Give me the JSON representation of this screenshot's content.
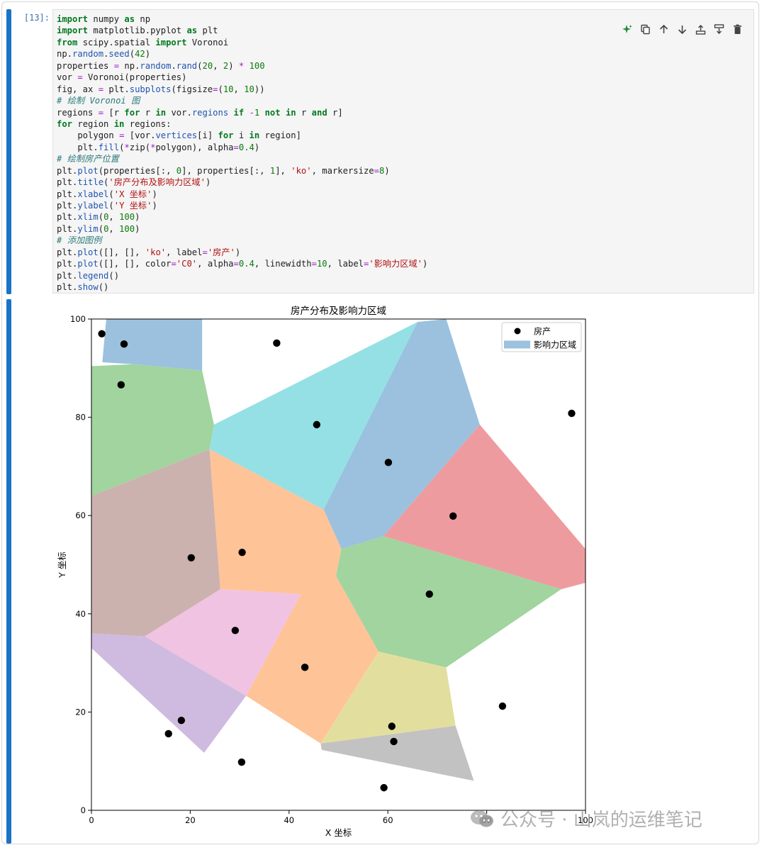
{
  "cell": {
    "prompt": "[13]:",
    "code_lines": [
      [
        [
          "kw",
          "import"
        ],
        [
          "t",
          " numpy "
        ],
        [
          "kw",
          "as"
        ],
        [
          "t",
          " np"
        ]
      ],
      [
        [
          "kw",
          "import"
        ],
        [
          "t",
          " matplotlib.pyplot "
        ],
        [
          "kw",
          "as"
        ],
        [
          "t",
          " plt"
        ]
      ],
      [
        [
          "kw",
          "from"
        ],
        [
          "t",
          " scipy.spatial "
        ],
        [
          "kw",
          "import"
        ],
        [
          "t",
          " Voronoi"
        ]
      ],
      [
        [
          "t",
          "np."
        ],
        [
          "fn",
          "random"
        ],
        [
          "t",
          "."
        ],
        [
          "fn",
          "seed"
        ],
        [
          "t",
          "("
        ],
        [
          "num",
          "42"
        ],
        [
          "t",
          ")"
        ]
      ],
      [
        [
          "t",
          "properties "
        ],
        [
          "op",
          "="
        ],
        [
          "t",
          " np."
        ],
        [
          "fn",
          "random"
        ],
        [
          "t",
          "."
        ],
        [
          "fn",
          "rand"
        ],
        [
          "t",
          "("
        ],
        [
          "num",
          "20"
        ],
        [
          "t",
          ", "
        ],
        [
          "num",
          "2"
        ],
        [
          "t",
          ") "
        ],
        [
          "op",
          "*"
        ],
        [
          "t",
          " "
        ],
        [
          "num",
          "100"
        ]
      ],
      [
        [
          "t",
          "vor "
        ],
        [
          "op",
          "="
        ],
        [
          "t",
          " Voronoi(properties)"
        ]
      ],
      [
        [
          "t",
          "fig, ax "
        ],
        [
          "op",
          "="
        ],
        [
          "t",
          " plt."
        ],
        [
          "fn",
          "subplots"
        ],
        [
          "t",
          "(figsize"
        ],
        [
          "op",
          "="
        ],
        [
          "t",
          "("
        ],
        [
          "num",
          "10"
        ],
        [
          "t",
          ", "
        ],
        [
          "num",
          "10"
        ],
        [
          "t",
          "))"
        ]
      ],
      [
        [
          "cm",
          "# 绘制 Voronoi 图"
        ]
      ],
      [
        [
          "t",
          "regions "
        ],
        [
          "op",
          "="
        ],
        [
          "t",
          " [r "
        ],
        [
          "kw",
          "for"
        ],
        [
          "t",
          " r "
        ],
        [
          "kw",
          "in"
        ],
        [
          "t",
          " vor."
        ],
        [
          "fn",
          "regions"
        ],
        [
          "t",
          " "
        ],
        [
          "kw",
          "if"
        ],
        [
          "t",
          " "
        ],
        [
          "op",
          "-"
        ],
        [
          "num",
          "1"
        ],
        [
          "t",
          " "
        ],
        [
          "kw",
          "not"
        ],
        [
          "t",
          " "
        ],
        [
          "kw",
          "in"
        ],
        [
          "t",
          " r "
        ],
        [
          "kw",
          "and"
        ],
        [
          "t",
          " r]"
        ]
      ],
      [
        [
          "kw",
          "for"
        ],
        [
          "t",
          " region "
        ],
        [
          "kw",
          "in"
        ],
        [
          "t",
          " regions:"
        ]
      ],
      [
        [
          "t",
          "    polygon "
        ],
        [
          "op",
          "="
        ],
        [
          "t",
          " [vor."
        ],
        [
          "fn",
          "vertices"
        ],
        [
          "t",
          "[i] "
        ],
        [
          "kw",
          "for"
        ],
        [
          "t",
          " i "
        ],
        [
          "kw",
          "in"
        ],
        [
          "t",
          " region]"
        ]
      ],
      [
        [
          "t",
          "    plt."
        ],
        [
          "fn",
          "fill"
        ],
        [
          "t",
          "("
        ],
        [
          "op",
          "*"
        ],
        [
          "t",
          "zip("
        ],
        [
          "op",
          "*"
        ],
        [
          "t",
          "polygon), alpha"
        ],
        [
          "op",
          "="
        ],
        [
          "num",
          "0.4"
        ],
        [
          "t",
          ")"
        ]
      ],
      [
        [
          "cm",
          "# 绘制房产位置"
        ]
      ],
      [
        [
          "t",
          "plt."
        ],
        [
          "fn",
          "plot"
        ],
        [
          "t",
          "(properties[:, "
        ],
        [
          "num",
          "0"
        ],
        [
          "t",
          "], properties[:, "
        ],
        [
          "num",
          "1"
        ],
        [
          "t",
          "], "
        ],
        [
          "str",
          "'ko'"
        ],
        [
          "t",
          ", markersize"
        ],
        [
          "op",
          "="
        ],
        [
          "num",
          "8"
        ],
        [
          "t",
          ")"
        ]
      ],
      [
        [
          "t",
          "plt."
        ],
        [
          "fn",
          "title"
        ],
        [
          "t",
          "("
        ],
        [
          "str",
          "'房产分布及影响力区域'"
        ],
        [
          "t",
          ")"
        ]
      ],
      [
        [
          "t",
          "plt."
        ],
        [
          "fn",
          "xlabel"
        ],
        [
          "t",
          "("
        ],
        [
          "str",
          "'X 坐标'"
        ],
        [
          "t",
          ")"
        ]
      ],
      [
        [
          "t",
          "plt."
        ],
        [
          "fn",
          "ylabel"
        ],
        [
          "t",
          "("
        ],
        [
          "str",
          "'Y 坐标'"
        ],
        [
          "t",
          ")"
        ]
      ],
      [
        [
          "t",
          "plt."
        ],
        [
          "fn",
          "xlim"
        ],
        [
          "t",
          "("
        ],
        [
          "num",
          "0"
        ],
        [
          "t",
          ", "
        ],
        [
          "num",
          "100"
        ],
        [
          "t",
          ")"
        ]
      ],
      [
        [
          "t",
          "plt."
        ],
        [
          "fn",
          "ylim"
        ],
        [
          "t",
          "("
        ],
        [
          "num",
          "0"
        ],
        [
          "t",
          ", "
        ],
        [
          "num",
          "100"
        ],
        [
          "t",
          ")"
        ]
      ],
      [
        [
          "cm",
          "# 添加图例"
        ]
      ],
      [
        [
          "t",
          "plt."
        ],
        [
          "fn",
          "plot"
        ],
        [
          "t",
          "([], [], "
        ],
        [
          "str",
          "'ko'"
        ],
        [
          "t",
          ", label"
        ],
        [
          "op",
          "="
        ],
        [
          "str",
          "'房产'"
        ],
        [
          "t",
          ")"
        ]
      ],
      [
        [
          "t",
          "plt."
        ],
        [
          "fn",
          "plot"
        ],
        [
          "t",
          "([], [], color"
        ],
        [
          "op",
          "="
        ],
        [
          "str",
          "'C0'"
        ],
        [
          "t",
          ", alpha"
        ],
        [
          "op",
          "="
        ],
        [
          "num",
          "0.4"
        ],
        [
          "t",
          ", linewidth"
        ],
        [
          "op",
          "="
        ],
        [
          "num",
          "10"
        ],
        [
          "t",
          ", label"
        ],
        [
          "op",
          "="
        ],
        [
          "str",
          "'影响力区域'"
        ],
        [
          "t",
          ")"
        ]
      ],
      [
        [
          "t",
          "plt."
        ],
        [
          "fn",
          "legend"
        ],
        [
          "t",
          "()"
        ]
      ],
      [
        [
          "t",
          "plt."
        ],
        [
          "fn",
          "show"
        ],
        [
          "t",
          "()"
        ]
      ]
    ],
    "toolbar": [
      {
        "name": "ai-assist-icon",
        "label": "AI assist"
      },
      {
        "name": "copy-icon",
        "label": "Duplicate"
      },
      {
        "name": "move-up-icon",
        "label": "Move up"
      },
      {
        "name": "move-down-icon",
        "label": "Move down"
      },
      {
        "name": "insert-above-icon",
        "label": "Insert above"
      },
      {
        "name": "insert-below-icon",
        "label": "Insert below"
      },
      {
        "name": "delete-icon",
        "label": "Delete"
      }
    ]
  },
  "watermark": "公众号 · 山岚的运维笔记",
  "chart_data": {
    "type": "scatter",
    "title": "房产分布及影响力区域",
    "xlabel": "X 坐标",
    "ylabel": "Y 坐标",
    "xlim": [
      0,
      100
    ],
    "ylim": [
      0,
      100
    ],
    "xticks": [
      0,
      20,
      40,
      60,
      80,
      100
    ],
    "yticks": [
      0,
      20,
      40,
      60,
      80,
      100
    ],
    "legend": [
      {
        "label": "房产",
        "kind": "marker",
        "color": "#000000"
      },
      {
        "label": "影响力区域",
        "kind": "patch",
        "color": "#9bc1de"
      }
    ],
    "legend_position": "top-right",
    "points": [
      [
        2.1,
        97.0
      ],
      [
        6.6,
        94.9
      ],
      [
        6.0,
        86.6
      ],
      [
        37.5,
        95.1
      ],
      [
        45.6,
        78.5
      ],
      [
        60.1,
        70.8
      ],
      [
        97.2,
        80.8
      ],
      [
        73.2,
        59.9
      ],
      [
        30.5,
        52.5
      ],
      [
        20.2,
        51.4
      ],
      [
        68.4,
        44.0
      ],
      [
        29.1,
        36.6
      ],
      [
        43.2,
        29.1
      ],
      [
        18.2,
        18.3
      ],
      [
        15.6,
        15.6
      ],
      [
        60.8,
        17.1
      ],
      [
        61.2,
        14.0
      ],
      [
        83.2,
        21.2
      ],
      [
        30.4,
        9.8
      ],
      [
        59.2,
        4.6
      ]
    ],
    "regions": [
      {
        "color": "#9bc1de",
        "vertices": [
          [
            2.2,
            91.2
          ],
          [
            3.0,
            100
          ],
          [
            22.4,
            100
          ],
          [
            22.4,
            89.5
          ],
          [
            8.5,
            90.8
          ]
        ]
      },
      {
        "color": "#a1d49e",
        "vertices": [
          [
            0,
            90.4
          ],
          [
            8.5,
            90.8
          ],
          [
            22.4,
            89.5
          ],
          [
            24.8,
            78.5
          ],
          [
            23.9,
            73.5
          ],
          [
            0,
            64.0
          ]
        ]
      },
      {
        "color": "#94e0e5",
        "vertices": [
          [
            24.8,
            78.5
          ],
          [
            66.0,
            99.4
          ],
          [
            47.0,
            61.2
          ],
          [
            23.9,
            73.5
          ]
        ]
      },
      {
        "color": "#9bc1de",
        "vertices": [
          [
            66.0,
            99.4
          ],
          [
            71.8,
            100
          ],
          [
            78.6,
            78.5
          ],
          [
            59.1,
            55.8
          ],
          [
            50.6,
            53.2
          ],
          [
            47.0,
            61.2
          ]
        ]
      },
      {
        "color": "#ee9b9f",
        "vertices": [
          [
            78.6,
            78.5
          ],
          [
            100,
            53.2
          ],
          [
            100,
            46.3
          ],
          [
            95.1,
            45.0
          ],
          [
            59.1,
            55.8
          ]
        ]
      },
      {
        "color": "#ccb2ae",
        "vertices": [
          [
            0,
            64.0
          ],
          [
            23.9,
            73.5
          ],
          [
            26.1,
            45.0
          ],
          [
            10.8,
            35.4
          ],
          [
            0,
            36.0
          ]
        ]
      },
      {
        "color": "#ffc398",
        "vertices": [
          [
            23.9,
            73.5
          ],
          [
            47.0,
            61.2
          ],
          [
            50.6,
            53.2
          ],
          [
            49.5,
            47.7
          ],
          [
            58.1,
            32.3
          ],
          [
            46.4,
            13.6
          ],
          [
            31.3,
            23.3
          ],
          [
            42.4,
            44.0
          ],
          [
            26.1,
            45.0
          ]
        ]
      },
      {
        "color": "#a1d49e",
        "vertices": [
          [
            50.6,
            53.2
          ],
          [
            59.1,
            55.8
          ],
          [
            95.1,
            45.0
          ],
          [
            71.8,
            29.1
          ],
          [
            58.1,
            32.3
          ],
          [
            49.5,
            47.7
          ]
        ]
      },
      {
        "color": "#f0c3e2",
        "vertices": [
          [
            26.1,
            45.0
          ],
          [
            42.4,
            44.0
          ],
          [
            31.3,
            23.3
          ],
          [
            10.8,
            35.4
          ]
        ]
      },
      {
        "color": "#cfbbe0",
        "vertices": [
          [
            0,
            36.0
          ],
          [
            10.8,
            35.4
          ],
          [
            31.3,
            23.3
          ],
          [
            22.8,
            11.7
          ],
          [
            0,
            33.0
          ]
        ]
      },
      {
        "color": "#e2df9e",
        "vertices": [
          [
            58.1,
            32.3
          ],
          [
            71.8,
            29.1
          ],
          [
            73.7,
            17.2
          ],
          [
            46.4,
            13.6
          ]
        ]
      },
      {
        "color": "#c2c2c2",
        "vertices": [
          [
            46.4,
            13.6
          ],
          [
            73.7,
            17.2
          ],
          [
            77.4,
            6.0
          ],
          [
            46.6,
            12.3
          ]
        ]
      }
    ]
  }
}
